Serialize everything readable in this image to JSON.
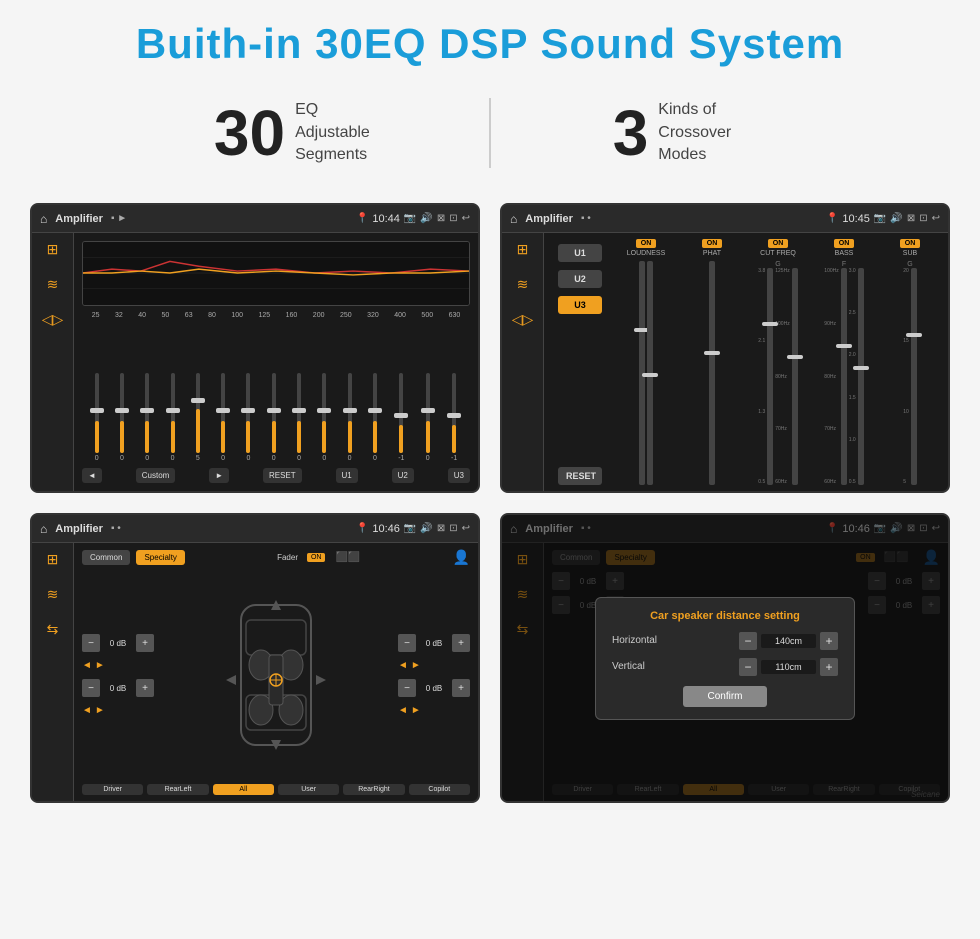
{
  "header": {
    "title": "Buith-in 30EQ DSP Sound System"
  },
  "stats": [
    {
      "number": "30",
      "text": "EQ Adjustable\nSegments"
    },
    {
      "number": "3",
      "text": "Kinds of\nCrossover Modes"
    }
  ],
  "screens": [
    {
      "id": "screen-eq-1",
      "topbar": {
        "title": "Amplifier",
        "time": "10:44"
      },
      "type": "eq",
      "freqs": [
        "25",
        "32",
        "40",
        "50",
        "63",
        "80",
        "100",
        "125",
        "160",
        "200",
        "250",
        "320",
        "400",
        "500",
        "630"
      ],
      "values": [
        "0",
        "0",
        "0",
        "0",
        "5",
        "0",
        "0",
        "0",
        "0",
        "0",
        "0",
        "0",
        "-1",
        "0",
        "-1"
      ],
      "slider_heights": [
        40,
        40,
        40,
        40,
        55,
        40,
        40,
        40,
        40,
        40,
        40,
        40,
        35,
        40,
        35
      ],
      "eq_preset": "Custom",
      "bottom_btns": [
        "◄",
        "Custom",
        "►",
        "RESET",
        "U1",
        "U2",
        "U3"
      ]
    },
    {
      "id": "screen-crossover",
      "topbar": {
        "title": "Amplifier",
        "time": "10:45"
      },
      "type": "crossover",
      "u_btns": [
        "U1",
        "U2",
        "U3"
      ],
      "channels": [
        {
          "label": "LOUDNESS",
          "on": true
        },
        {
          "label": "PHAT",
          "on": true
        },
        {
          "label": "CUT FREQ",
          "on": true
        },
        {
          "label": "BASS",
          "on": true
        },
        {
          "label": "SUB",
          "on": true
        }
      ]
    },
    {
      "id": "screen-specialty",
      "topbar": {
        "title": "Amplifier",
        "time": "10:46"
      },
      "type": "specialty",
      "tabs": [
        "Common",
        "Specialty"
      ],
      "active_tab": "Specialty",
      "fader": "Fader",
      "fader_on": "ON",
      "volumes": [
        {
          "label": "",
          "value": "0 dB"
        },
        {
          "label": "",
          "value": "0 dB"
        },
        {
          "label": "",
          "value": "0 dB"
        },
        {
          "label": "",
          "value": "0 dB"
        }
      ],
      "speaker_btns": [
        "Driver",
        "RearLeft",
        "All",
        "User",
        "RearRight",
        "Copilot"
      ]
    },
    {
      "id": "screen-dialog",
      "topbar": {
        "title": "Amplifier",
        "time": "10:46"
      },
      "type": "dialog",
      "tabs": [
        "Common",
        "Specialty"
      ],
      "active_tab": "Specialty",
      "dialog": {
        "title": "Car speaker distance setting",
        "rows": [
          {
            "label": "Horizontal",
            "value": "140cm"
          },
          {
            "label": "Vertical",
            "value": "110cm"
          }
        ],
        "confirm_label": "Confirm"
      },
      "speaker_btns": [
        "Driver",
        "RearLeft",
        "All",
        "User",
        "RearRight",
        "Copilot"
      ]
    }
  ],
  "watermark": "Seicane"
}
